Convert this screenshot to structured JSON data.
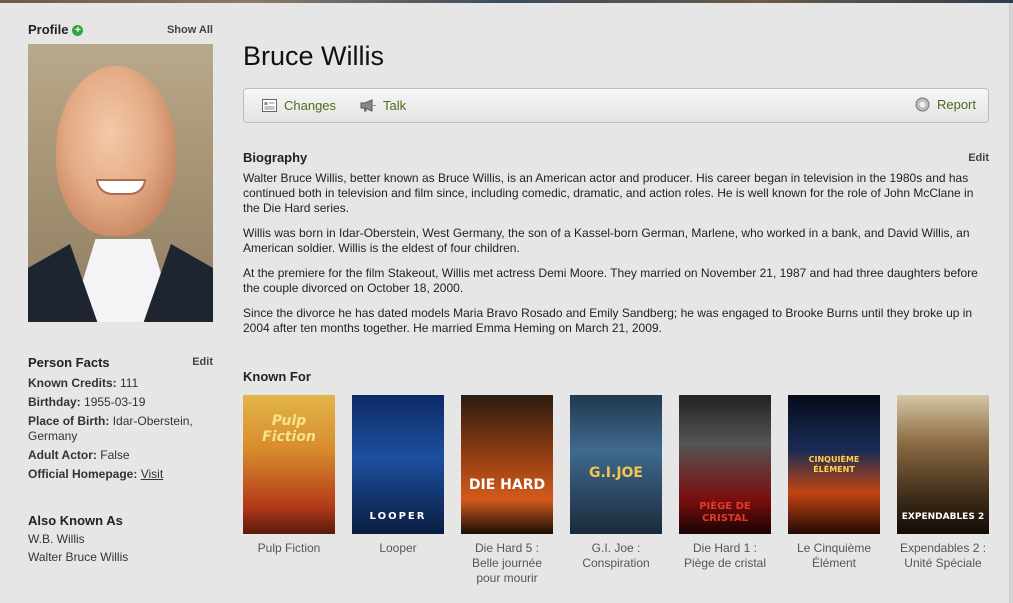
{
  "sidebar": {
    "profile": {
      "title": "Profile",
      "show_all": "Show All"
    },
    "person_facts": {
      "title": "Person Facts",
      "edit": "Edit",
      "known_credits_label": "Known Credits:",
      "known_credits_value": "111",
      "birthday_label": "Birthday:",
      "birthday_value": "1955-03-19",
      "place_of_birth_label": "Place of Birth:",
      "place_of_birth_value": "Idar-Oberstein, Germany",
      "adult_actor_label": "Adult Actor:",
      "adult_actor_value": "False",
      "homepage_label": "Official Homepage:",
      "homepage_link": "Visit"
    },
    "also_known_as": {
      "title": "Also Known As",
      "items": [
        "W.B. Willis",
        "Walter Bruce Willis"
      ]
    }
  },
  "main": {
    "name": "Bruce Willis",
    "toolbar": {
      "changes": "Changes",
      "talk": "Talk",
      "report": "Report"
    },
    "biography": {
      "title": "Biography",
      "edit": "Edit",
      "paragraphs": [
        "Walter Bruce Willis, better known as Bruce Willis, is an American actor and producer. His career began in television in the 1980s and has continued both in television and film since, including comedic, dramatic, and action roles. He is well known for the role of John McClane in the Die Hard series.",
        "Willis was born in Idar-Oberstein, West Germany, the son of a Kassel-born German, Marlene, who worked in a bank, and David Willis, an American soldier. Willis is the eldest of four children.",
        "At the premiere for the film Stakeout, Willis met actress Demi Moore. They married on November 21, 1987 and had three daughters before the couple divorced on October 18, 2000.",
        "Since the divorce he has dated models Maria Bravo Rosado and Emily Sandberg; he was engaged to Brooke Burns until they broke up in 2004 after ten months together. He married Emma Heming on March 21, 2009."
      ]
    },
    "known_for": {
      "title": "Known For",
      "movies": [
        {
          "caption": "Pulp Fiction",
          "poster_text": "Pulp Fiction"
        },
        {
          "caption": "Looper",
          "poster_text": "LOOPER"
        },
        {
          "caption": "Die Hard 5 : Belle journée pour mourir",
          "poster_text": "DIE HARD"
        },
        {
          "caption": "G.I. Joe : Conspiration",
          "poster_text": "G.I.JOE"
        },
        {
          "caption": "Die Hard 1 : Piège de cristal",
          "poster_text": "PIÈGE DE CRISTAL"
        },
        {
          "caption": "Le Cinquième Élément",
          "poster_text": "CINQUIÈME ÉLÉMENT"
        },
        {
          "caption": "Expendables 2 : Unité Spéciale",
          "poster_text": "EXPENDABLES 2"
        }
      ]
    }
  },
  "colors": {
    "accent_link": "#4f6b1c",
    "plus_green": "#2fa83d",
    "background": "#e6e6e6"
  }
}
